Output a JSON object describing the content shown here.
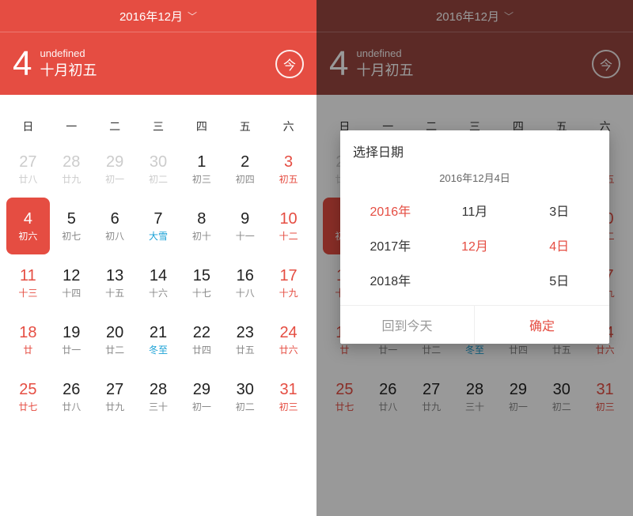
{
  "header": {
    "title": "2016年12月",
    "big_day": "4",
    "undefined_label": "undefined",
    "lunar_date": "十月初五",
    "today_btn": "今"
  },
  "weekdays": [
    "日",
    "一",
    "二",
    "三",
    "四",
    "五",
    "六"
  ],
  "cells": [
    {
      "n": "27",
      "s": "廿八",
      "cls": "other"
    },
    {
      "n": "28",
      "s": "廿九",
      "cls": "other"
    },
    {
      "n": "29",
      "s": "初一",
      "cls": "other"
    },
    {
      "n": "30",
      "s": "初二",
      "cls": "other"
    },
    {
      "n": "1",
      "s": "初三",
      "cls": ""
    },
    {
      "n": "2",
      "s": "初四",
      "cls": ""
    },
    {
      "n": "3",
      "s": "初五",
      "cls": "weekend"
    },
    {
      "n": "4",
      "s": "初六",
      "cls": "weekend selected"
    },
    {
      "n": "5",
      "s": "初七",
      "cls": ""
    },
    {
      "n": "6",
      "s": "初八",
      "cls": ""
    },
    {
      "n": "7",
      "s": "大雪",
      "cls": "solar"
    },
    {
      "n": "8",
      "s": "初十",
      "cls": ""
    },
    {
      "n": "9",
      "s": "十一",
      "cls": ""
    },
    {
      "n": "10",
      "s": "十二",
      "cls": "weekend"
    },
    {
      "n": "11",
      "s": "十三",
      "cls": "weekend"
    },
    {
      "n": "12",
      "s": "十四",
      "cls": ""
    },
    {
      "n": "13",
      "s": "十五",
      "cls": ""
    },
    {
      "n": "14",
      "s": "十六",
      "cls": ""
    },
    {
      "n": "15",
      "s": "十七",
      "cls": ""
    },
    {
      "n": "16",
      "s": "十八",
      "cls": ""
    },
    {
      "n": "17",
      "s": "十九",
      "cls": "weekend"
    },
    {
      "n": "18",
      "s": "廿",
      "cls": "weekend"
    },
    {
      "n": "19",
      "s": "廿一",
      "cls": ""
    },
    {
      "n": "20",
      "s": "廿二",
      "cls": ""
    },
    {
      "n": "21",
      "s": "冬至",
      "cls": "solar"
    },
    {
      "n": "22",
      "s": "廿四",
      "cls": ""
    },
    {
      "n": "23",
      "s": "廿五",
      "cls": ""
    },
    {
      "n": "24",
      "s": "廿六",
      "cls": "weekend"
    },
    {
      "n": "25",
      "s": "廿七",
      "cls": "weekend"
    },
    {
      "n": "26",
      "s": "廿八",
      "cls": ""
    },
    {
      "n": "27",
      "s": "廿九",
      "cls": ""
    },
    {
      "n": "28",
      "s": "三十",
      "cls": ""
    },
    {
      "n": "29",
      "s": "初一",
      "cls": ""
    },
    {
      "n": "30",
      "s": "初二",
      "cls": ""
    },
    {
      "n": "31",
      "s": "初三",
      "cls": "weekend"
    }
  ],
  "modal": {
    "title": "选择日期",
    "current": "2016年12月4日",
    "years": [
      "2016年",
      "2017年",
      "2018年"
    ],
    "months": [
      "11月",
      "12月",
      ""
    ],
    "days": [
      "3日",
      "4日",
      "5日"
    ],
    "year_sel": 0,
    "month_sel": 1,
    "day_sel": 1,
    "back": "回到今天",
    "ok": "确定"
  }
}
